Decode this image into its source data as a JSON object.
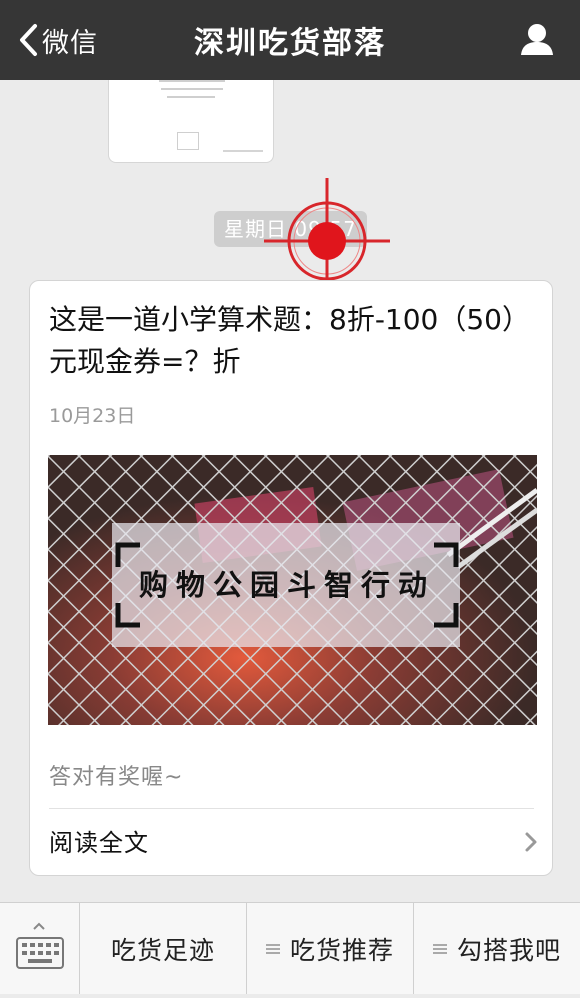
{
  "header": {
    "back_label": "微信",
    "title": "深圳吃货部落",
    "back_icon": "chevron-left-icon",
    "profile_icon": "person-icon"
  },
  "timestamp": "星期日 09:57",
  "article": {
    "title": "这是一道小学算术题：8折-100（50）元现金券=？折",
    "date": "10月23日",
    "image_text": "购物公园斗智行动",
    "description": "答对有奖喔~",
    "read_more": "阅读全文"
  },
  "bottom_menu": {
    "keyboard_icon": "keyboard-icon",
    "items": [
      {
        "label": "吃货足迹",
        "icon": ""
      },
      {
        "label": "吃货推荐",
        "icon": "menu-lines-icon"
      },
      {
        "label": "勾搭我吧",
        "icon": "menu-lines-icon"
      }
    ]
  },
  "colors": {
    "header_bg": "#363636",
    "page_bg": "#ebebeb",
    "crosshair": "#d8262b"
  }
}
